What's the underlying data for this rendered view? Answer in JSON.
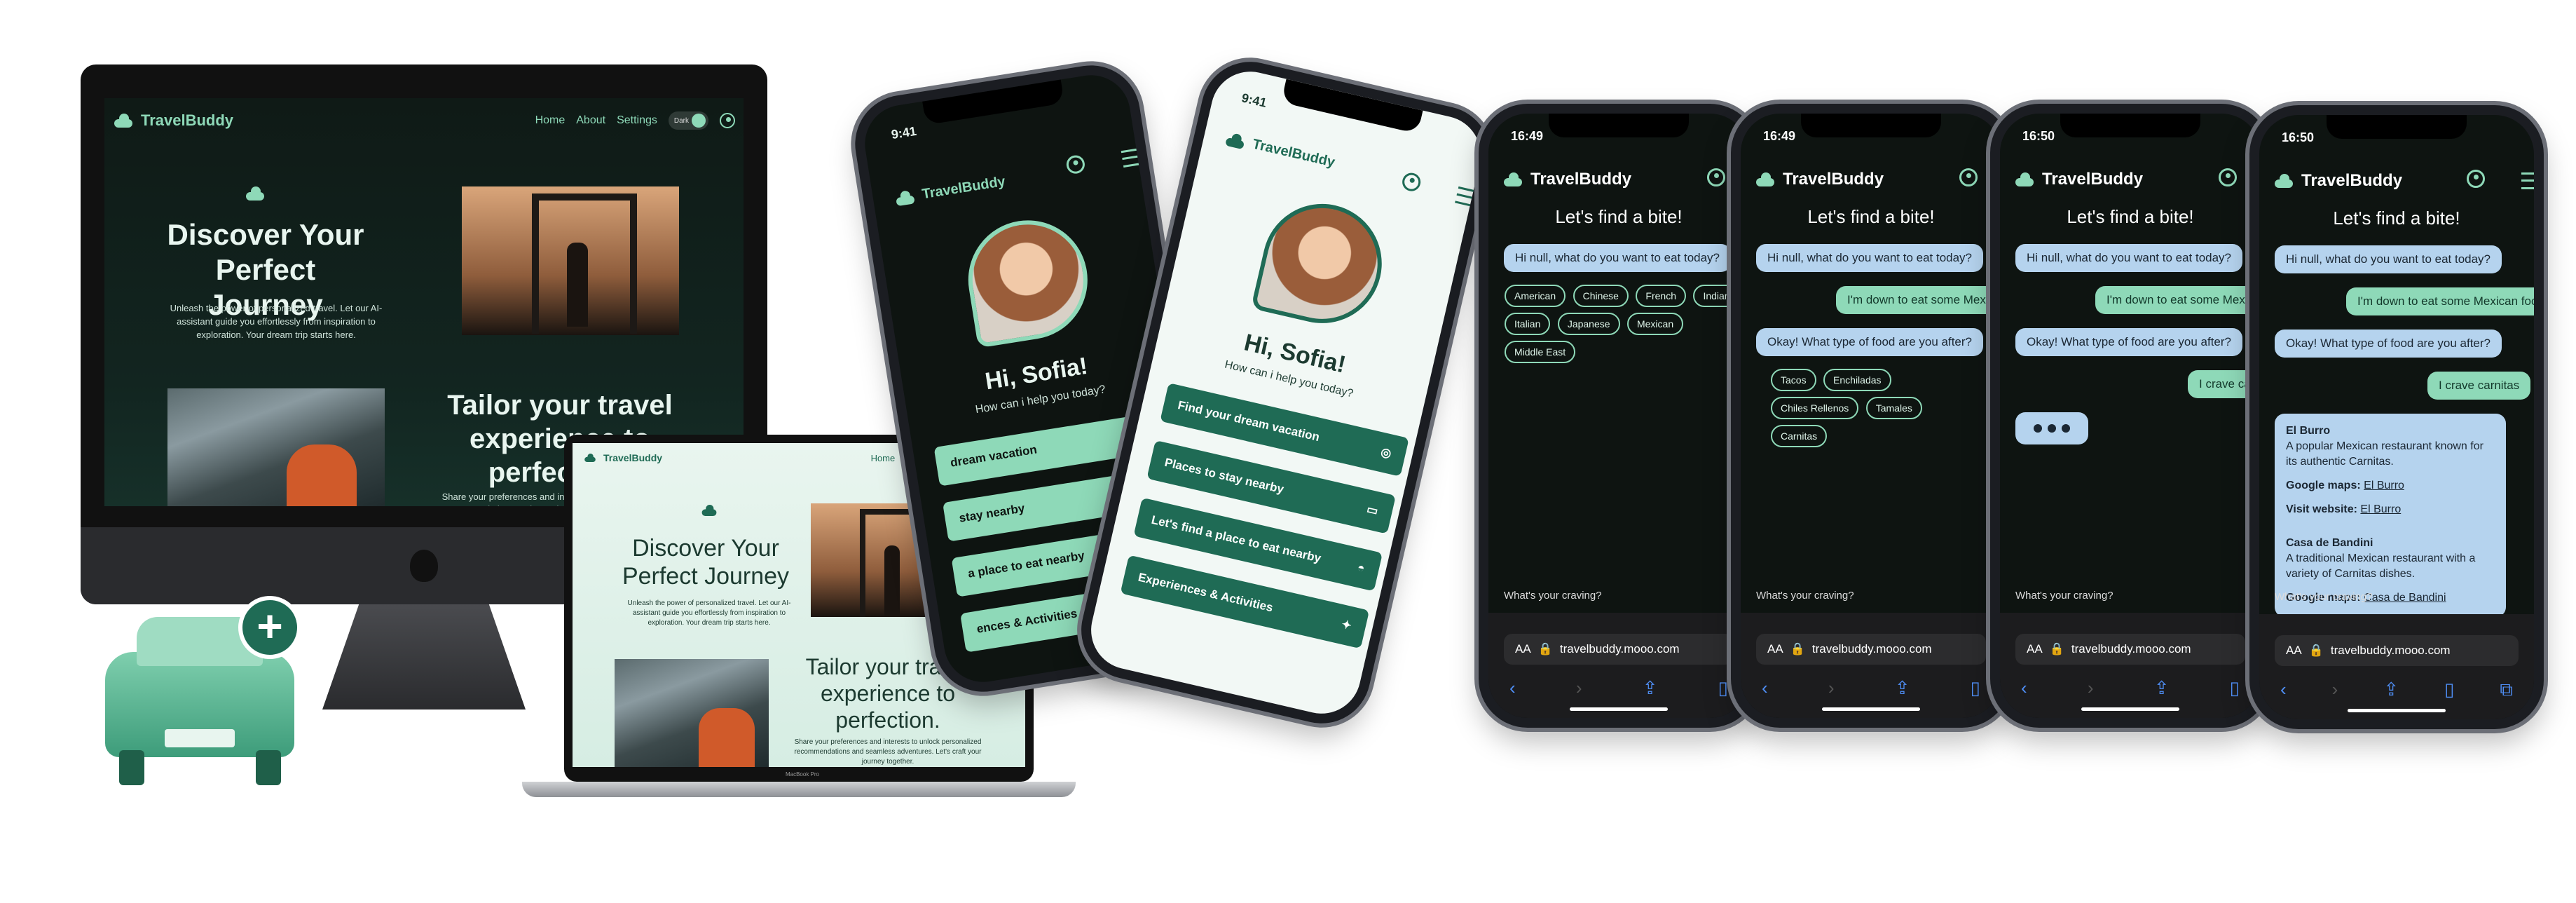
{
  "brand": {
    "name": "TravelBuddy"
  },
  "desktop": {
    "nav": [
      "Home",
      "About",
      "Settings"
    ],
    "toggle_label": "Dark",
    "hero_title": "Discover Your Perfect Journey",
    "hero_text": "Unleash the power of personalized travel. Let our AI-assistant guide you effortlessly from inspiration to exploration. Your dream trip starts here.",
    "tailor_title": "Tailor your travel experience to perfection.",
    "tailor_text": "Share your preferences and interests to unlock personalized recommendations and seamless adventures. Let's craft your journey together."
  },
  "laptop": {
    "label": "MacBook Pro"
  },
  "home_phone": {
    "time": "9:41",
    "greeting": "Hi, Sofia!",
    "prompt": "How can i help you today?",
    "menu": [
      "Find your dream vacation",
      "Places to stay nearby",
      "Let's find a place to eat nearby",
      "Experiences & Activities"
    ],
    "dark_menu": [
      "dream vacation",
      "stay nearby",
      "a place to eat nearby",
      "ences & Activities"
    ]
  },
  "chat": {
    "title": "Let's find a bite!",
    "q1": "Hi null, what do you want to eat today?",
    "cuisines": [
      "American",
      "Chinese",
      "French",
      "Indian",
      "Italian",
      "Japanese",
      "Mexican",
      "Middle East"
    ],
    "a1": "I'm down to eat some Mexican food",
    "q2": "Okay! What type of food are you after?",
    "dishes": [
      "Tacos",
      "Enchiladas",
      "Chiles Rellenos",
      "Tamales",
      "Carnitas"
    ],
    "a2": "I crave carnitas",
    "r1_name": "El Burro",
    "r1_desc": "A popular Mexican restaurant known for its authentic Carnitas.",
    "maps_label": "Google maps:",
    "r1_maps": "El Burro",
    "web_label": "Visit website:",
    "r1_web": "El Burro",
    "r2_name": "Casa de Bandini",
    "r2_desc": "A traditional Mexican restaurant with a variety of Carnitas dishes.",
    "r2_maps": "Casa de Bandini",
    "input_label": "What's your craving?",
    "url": "travelbuddy.mooo.com",
    "aa": "AA",
    "times": [
      "16:49",
      "16:49",
      "16:50",
      "16:50"
    ]
  },
  "colors": {
    "accent": "#8ed9b8",
    "dark": "#0e1411",
    "brand_green": "#1f6b55"
  }
}
